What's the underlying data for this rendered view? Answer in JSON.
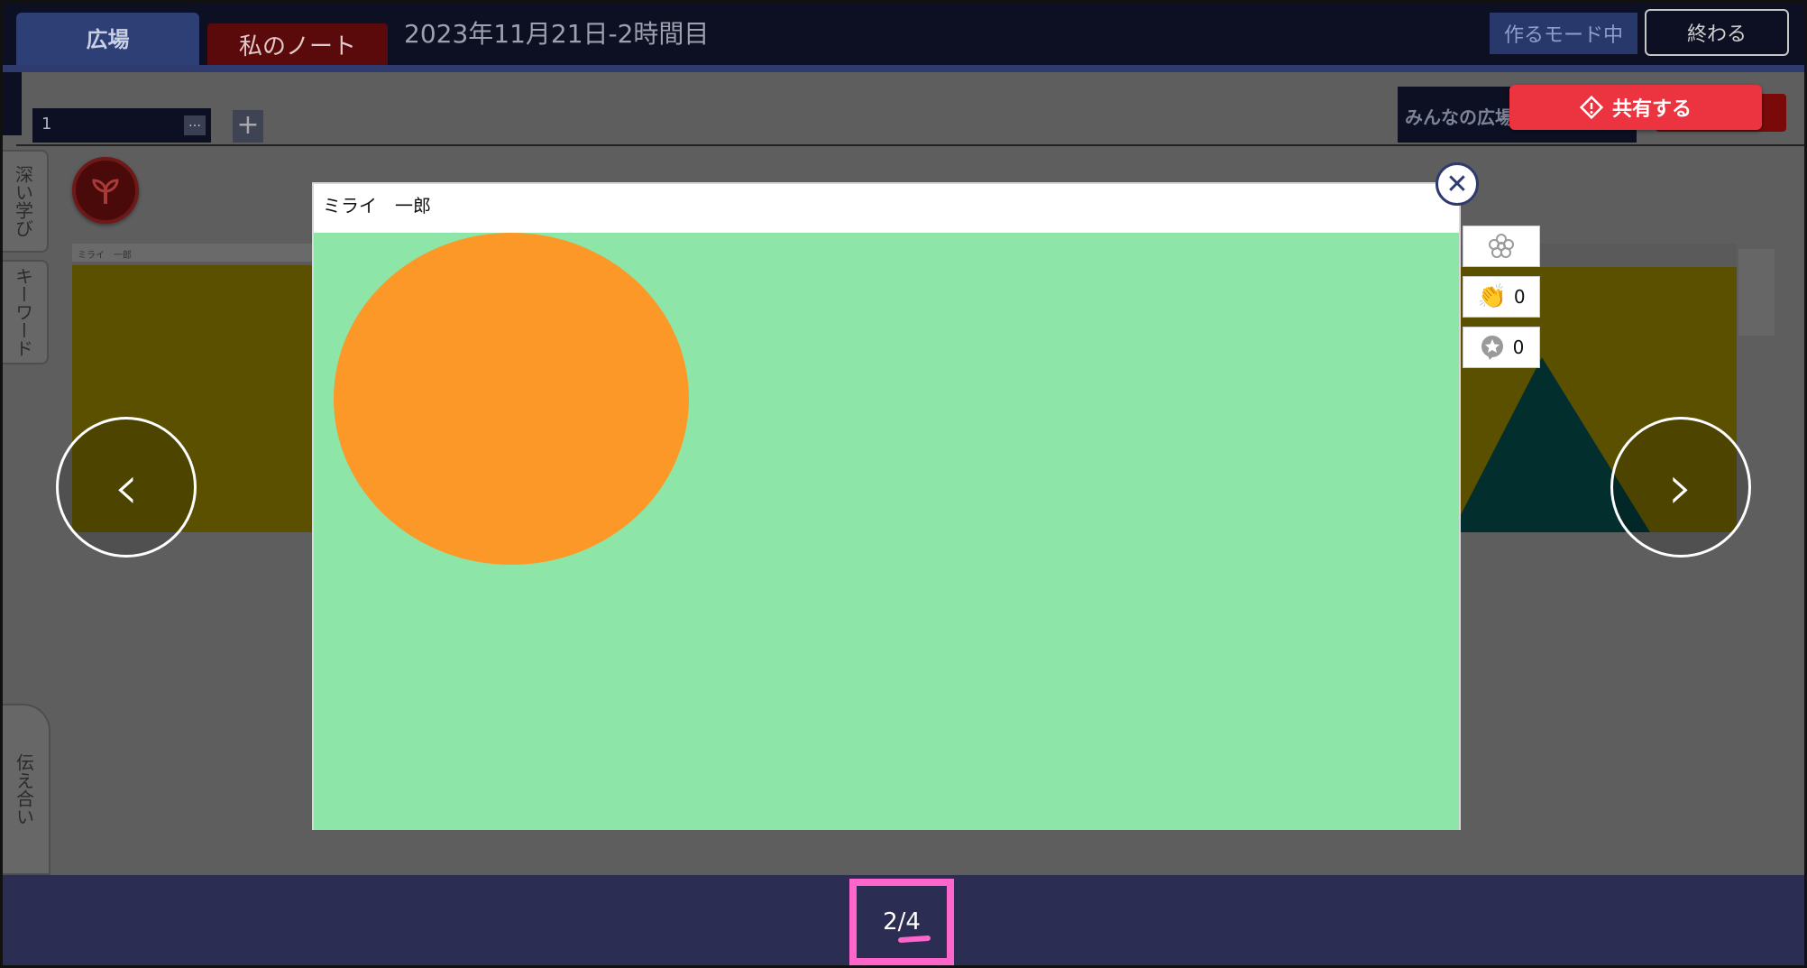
{
  "header": {
    "tab_hiroba": "広場",
    "tab_note": "私のノート",
    "lesson_title": "2023年11月21日-2時間目",
    "mode_badge": "作るモード中",
    "end_button": "終わる"
  },
  "tabs": {
    "page_tab_label": "1",
    "page_tab_more": "…",
    "add_tab": "+",
    "everyone_tab": "みんなの広場",
    "share_button": "共有する"
  },
  "side_tabs": {
    "deep_learning": "深い学び",
    "keyword": "キーワード",
    "tsutae": "伝え合い"
  },
  "background_card": {
    "author": "ミライ　一郎"
  },
  "modal": {
    "author": "ミライ　一郎",
    "close_icon": "close-icon",
    "canvas_color": "#8de6a8",
    "shape_color": "#fb9828"
  },
  "reactions": {
    "clap_count": "0",
    "comment_count": "0"
  },
  "navigation": {
    "prev": "‹",
    "next": "›"
  },
  "footer": {
    "page_indicator": "2/4"
  }
}
